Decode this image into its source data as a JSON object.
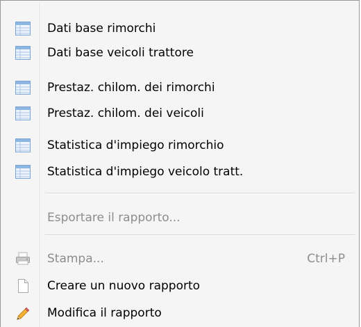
{
  "menu": {
    "items": [
      {
        "label": "Dati base rimorchi",
        "icon": "report-table-icon"
      },
      {
        "label": "Dati base veicoli trattore",
        "icon": "report-table-icon"
      },
      {
        "label": "Prestaz. chilom. dei rimorchi",
        "icon": "report-table-icon"
      },
      {
        "label": "Prestaz. chilom. dei veicoli",
        "icon": "report-table-icon"
      },
      {
        "label": "Statistica d'impiego rimorchio",
        "icon": "report-table-icon"
      },
      {
        "label": "Statistica d'impiego veicolo tratt.",
        "icon": "report-table-icon"
      }
    ],
    "export": {
      "label": "Esportare il rapporto...",
      "enabled": false
    },
    "print": {
      "label": "Stampa...",
      "shortcut": "Ctrl+P",
      "enabled": false,
      "icon": "printer-icon"
    },
    "new_report": {
      "label": "Creare un nuovo rapporto",
      "icon": "new-document-icon"
    },
    "edit_report": {
      "label": "Modifica il rapporto",
      "icon": "pencil-icon"
    }
  },
  "colors": {
    "menu_background": "#f5f5f5",
    "disabled_text": "#8d8d8d",
    "icon_blue": "#6f9fd4"
  }
}
